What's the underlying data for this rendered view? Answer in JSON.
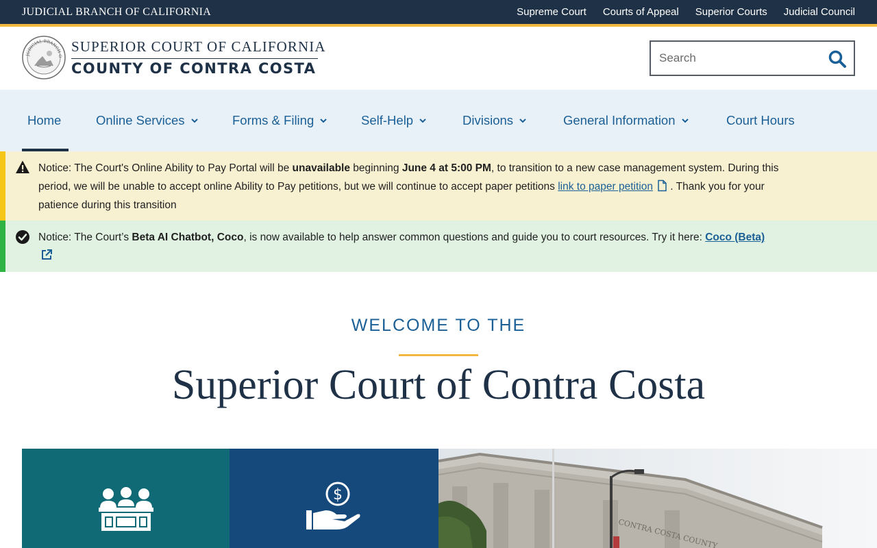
{
  "utility_bar": {
    "branch_name": "JUDICIAL BRANCH OF CALIFORNIA",
    "links": [
      "Supreme Court",
      "Courts of Appeal",
      "Superior Courts",
      "Judicial Council"
    ]
  },
  "header": {
    "logo_line1": "SUPERIOR COURT OF CALIFORNIA",
    "logo_line2": "COUNTY OF CONTRA COSTA",
    "seal_text": "JUDICIAL BRANCH OF CALIFORNIA",
    "search_placeholder": "Search"
  },
  "nav": {
    "items": [
      {
        "label": "Home",
        "active": true
      },
      {
        "label": "Online Services",
        "dropdown": true
      },
      {
        "label": "Forms & Filing",
        "dropdown": true
      },
      {
        "label": "Self-Help",
        "dropdown": true
      },
      {
        "label": "Divisions",
        "dropdown": true
      },
      {
        "label": "General Information",
        "dropdown": true
      },
      {
        "label": "Court Hours"
      }
    ]
  },
  "notices": {
    "yellow": {
      "t1": "Notice: The Court's Online Ability to Pay Portal will be ",
      "b1": "unavailable",
      "t2": " beginning ",
      "b2": "June 4 at 5:00 PM",
      "t3": ", to transition to a new case management system. During this period, we will be unable to accept online Ability to Pay petitions, but we will continue to accept paper petitions ",
      "link": "link to paper petition",
      "t4": " . Thank you for your patience during this transition"
    },
    "green": {
      "t1": "Notice: The Court’s ",
      "b1": "Beta AI Chatbot, Coco",
      "t2": ", is now available to help answer common questions and guide you to court resources. Try it here: ",
      "link": "Coco (Beta)"
    }
  },
  "welcome": {
    "kicker": "WELCOME TO THE",
    "title": "Superior Court of Contra Costa"
  },
  "tiles": {
    "photo_building_inscription": "CONTRA COSTA COUNTY"
  },
  "colors": {
    "topbar": "#1f3146",
    "gold": "#f2b73f",
    "link_blue": "#1a5f96",
    "nav_bg": "#e9f1f8",
    "notice_yellow": "#f7f0d1",
    "notice_green": "#e1f2e2",
    "tile_teal": "#0f6a76",
    "tile_navy": "#16497b"
  },
  "icons": {
    "notice_yellow": "warning-icon",
    "notice_green": "check-circle-icon",
    "search": "search-icon",
    "tile_1": "jury-icon",
    "tile_2": "payment-hand-icon"
  }
}
